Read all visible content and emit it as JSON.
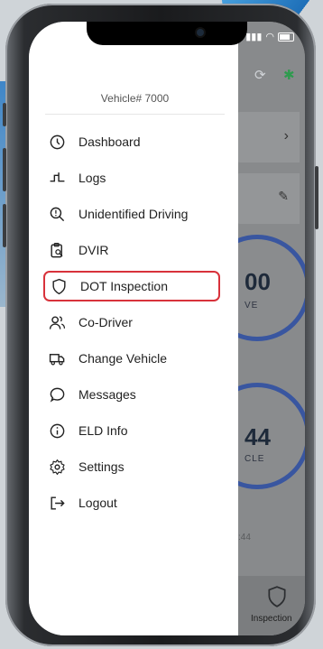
{
  "drawer": {
    "vehicle_label": "Vehicle# 7000",
    "items": [
      {
        "label": "Dashboard",
        "icon": "clock-icon"
      },
      {
        "label": "Logs",
        "icon": "logs-icon"
      },
      {
        "label": "Unidentified Driving",
        "icon": "search-icon"
      },
      {
        "label": "DVIR",
        "icon": "clipboard-search-icon"
      },
      {
        "label": "DOT Inspection",
        "icon": "shield-icon",
        "highlighted": true
      },
      {
        "label": "Co-Driver",
        "icon": "users-icon"
      },
      {
        "label": "Change Vehicle",
        "icon": "truck-icon"
      },
      {
        "label": "Messages",
        "icon": "message-icon"
      },
      {
        "label": "ELD Info",
        "icon": "info-icon"
      },
      {
        "label": "Settings",
        "icon": "gear-icon"
      },
      {
        "label": "Logout",
        "icon": "logout-icon"
      }
    ]
  },
  "background_app": {
    "ring1_value": "00",
    "ring1_sub": "VE",
    "ring2_value": "44",
    "ring2_sub": "CLE",
    "footer_time": ":44",
    "bottom_tab_label": "Inspection"
  },
  "colors": {
    "highlight_border": "#d8323b",
    "ring": "#3956a0"
  }
}
